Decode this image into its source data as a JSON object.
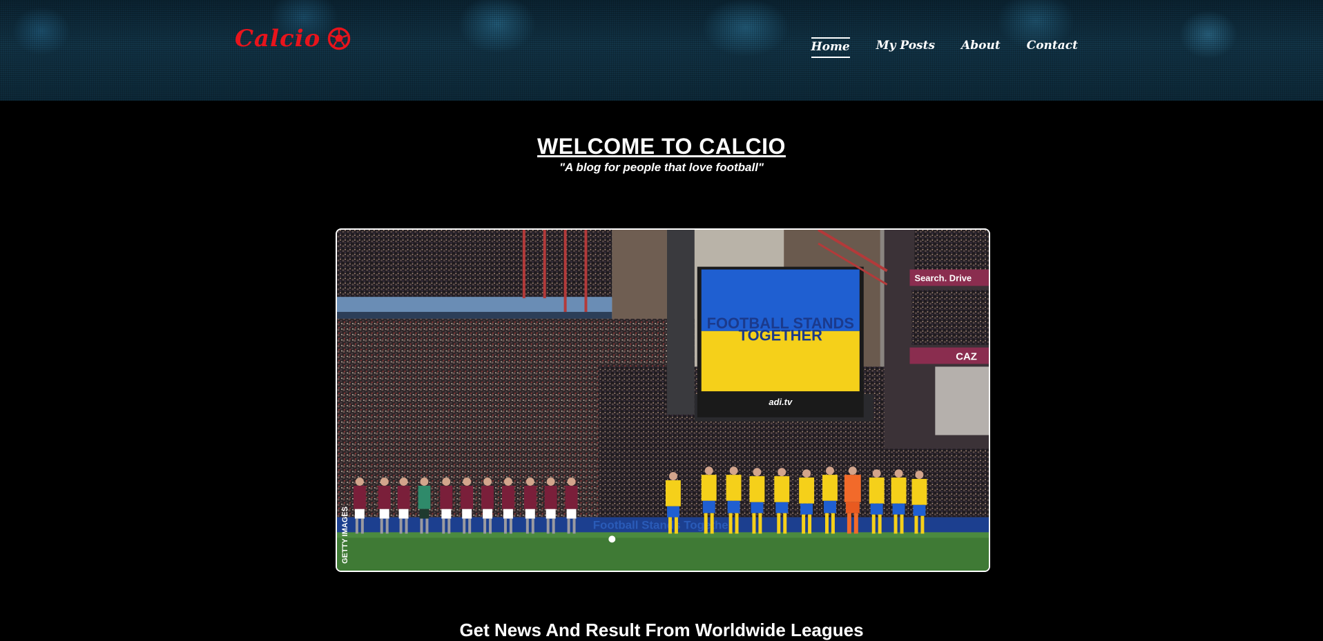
{
  "header": {
    "logo_text": "Calcio",
    "logo_icon": "soccer-ball-icon",
    "nav": [
      {
        "label": "Home",
        "active": true
      },
      {
        "label": "My Posts",
        "active": false
      },
      {
        "label": "About",
        "active": false
      },
      {
        "label": "Contact",
        "active": false
      }
    ]
  },
  "hero": {
    "title": "WELCOME TO CALCIO",
    "subtitle": "\"A blog for people that love football\""
  },
  "feature_image": {
    "screen_line1": "FOOTBALL STANDS",
    "screen_line2": "TOGETHER",
    "screen_sponsor": "adi.tv",
    "board_text": "Football Stands Together",
    "side_sign1": "Search. Drive",
    "side_sign2": "CAZ",
    "credit": "GETTY IMAGES"
  },
  "section": {
    "heading": "Get News And Result From Worldwide Leagues"
  },
  "colors": {
    "logo_red": "#e8141c",
    "background": "#000000",
    "header_blue": "#123447",
    "ukraine_blue": "#1f5fd1",
    "ukraine_yellow": "#f5d01a"
  }
}
